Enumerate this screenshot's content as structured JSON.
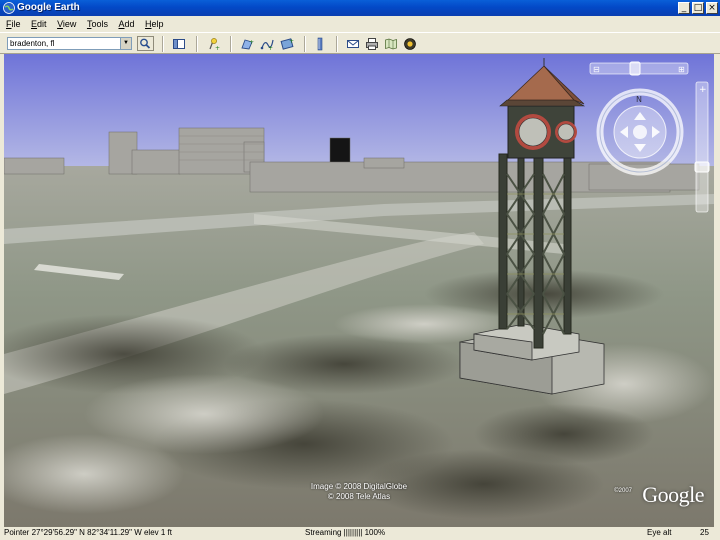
{
  "window": {
    "title": "Google Earth"
  },
  "menu": [
    {
      "mnemonic": "F",
      "rest": "ile"
    },
    {
      "mnemonic": "E",
      "rest": "dit"
    },
    {
      "mnemonic": "V",
      "rest": "iew"
    },
    {
      "mnemonic": "T",
      "rest": "ools"
    },
    {
      "mnemonic": "A",
      "rest": "dd"
    },
    {
      "mnemonic": "H",
      "rest": "elp"
    }
  ],
  "search": {
    "value": "bradenton, fl"
  },
  "viewport": {
    "credit_line1": "Image © 2008 DigitalGlobe",
    "credit_line2": "© 2008 Tele Atlas",
    "google_copyright": "©2007",
    "google_logo": "Google"
  },
  "status": {
    "pointer": "Pointer  27°29'56.29\" N    82°34'11.29\" W   elev   1 ft",
    "streaming": "Streaming |||||||||  100%",
    "eye_alt": "Eye alt",
    "extra": "25"
  },
  "colors": {
    "title_bar": "#0349c7",
    "sky_top": "#6f74d8",
    "sky_bottom": "#b8bce6",
    "tower": "#3a3f36",
    "roof": "#a56a4d"
  },
  "icons": [
    "google-earth-icon",
    "search-icon",
    "sidebar-toggle-icon",
    "placemark-icon",
    "polygon-icon",
    "path-icon",
    "image-overlay-icon",
    "ruler-icon",
    "email-icon",
    "print-icon",
    "map-icon",
    "sky-icon"
  ]
}
